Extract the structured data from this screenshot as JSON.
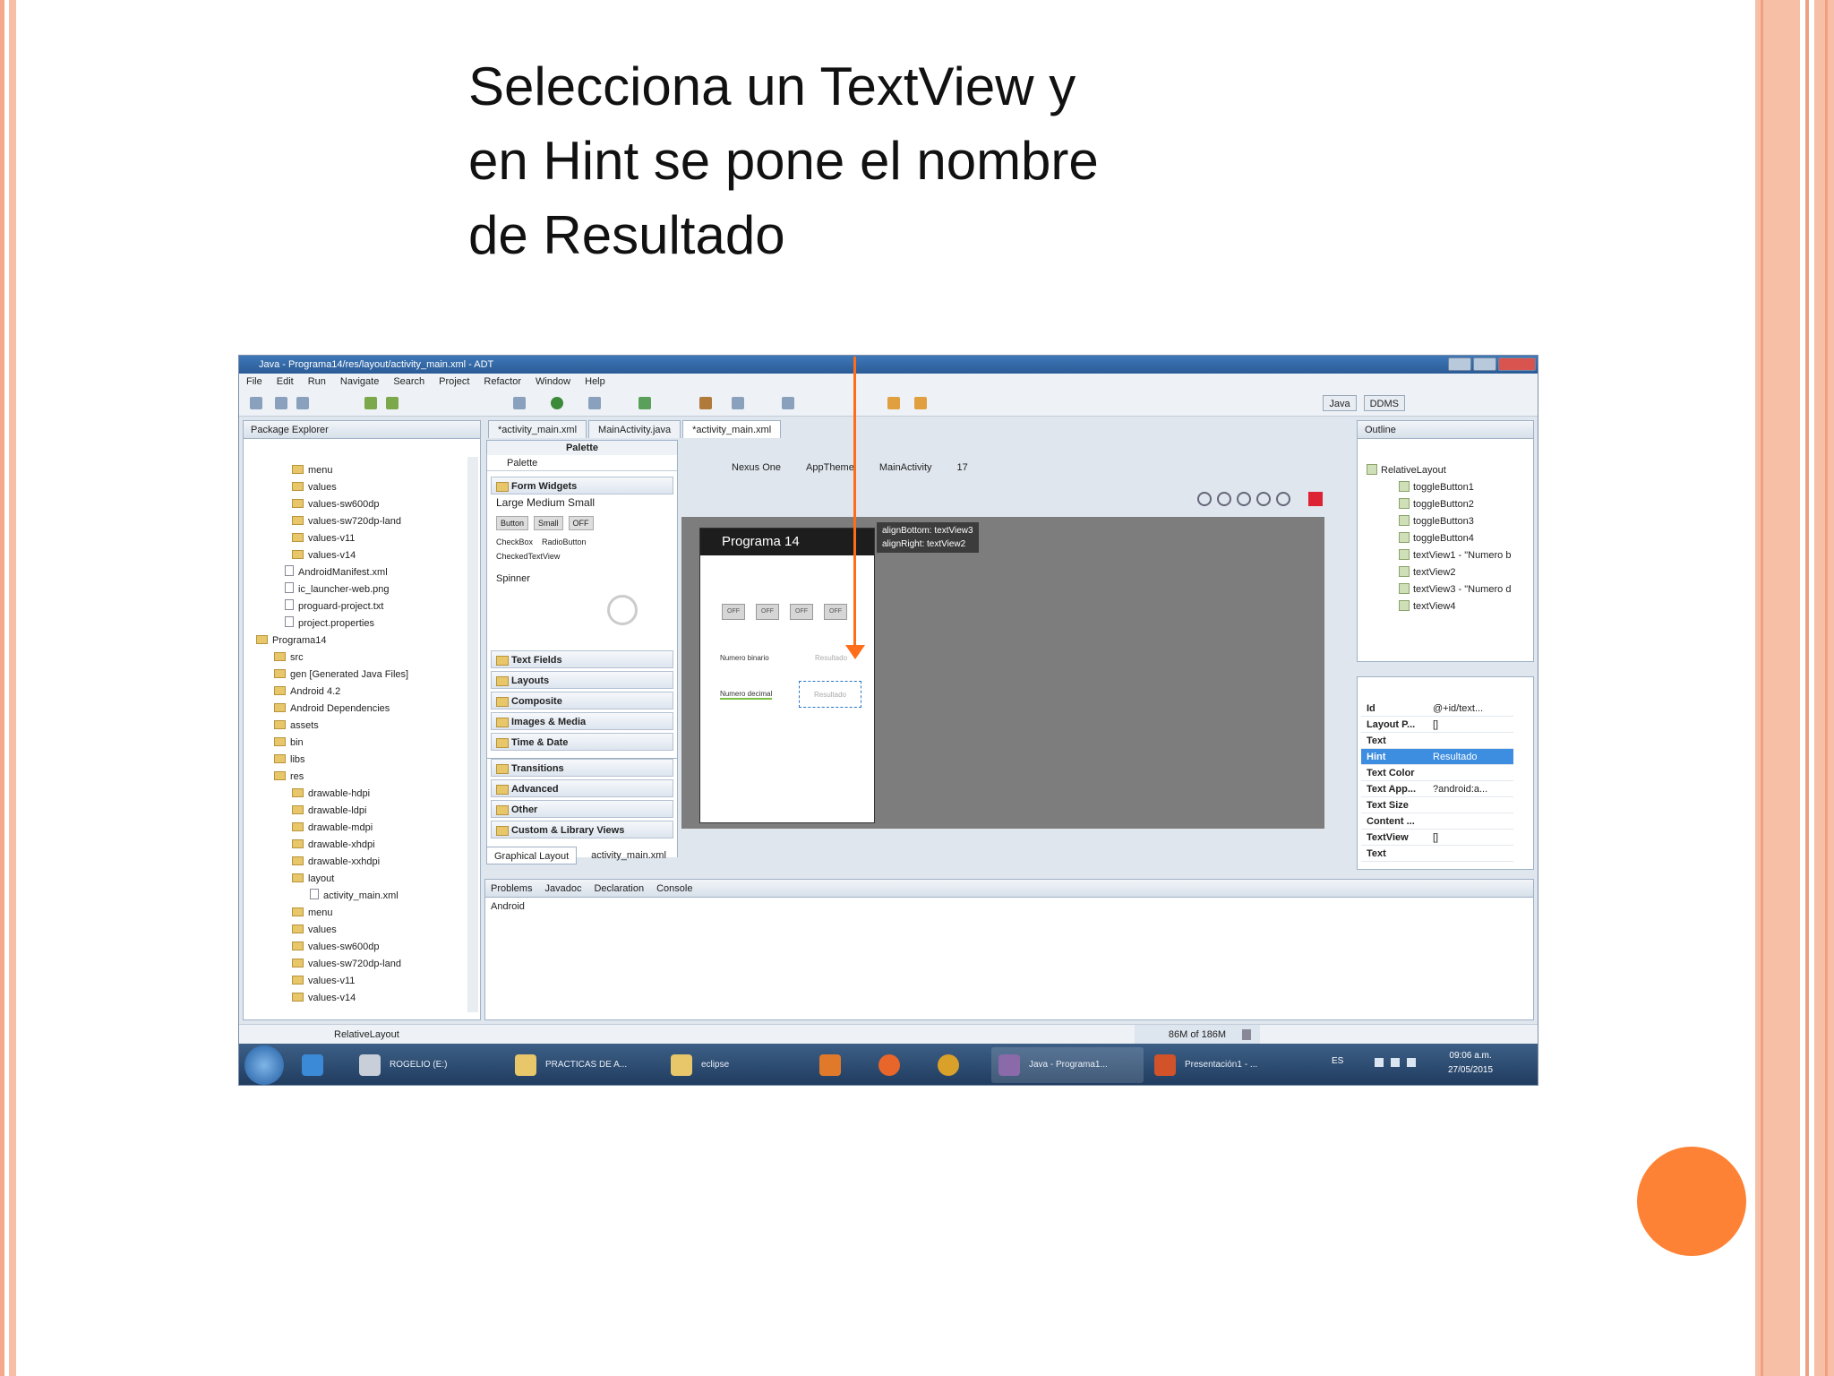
{
  "slide": {
    "title_lines": [
      "Selecciona un TextView y",
      "en Hint se pone el nombre",
      "de Resultado"
    ],
    "colors": {
      "accent": "#fe8236",
      "rail": "#f7c0a6",
      "arrow": "#ff6c1a"
    }
  },
  "ide": {
    "window_title": "Java - Programa14/res/layout/activity_main.xml - ADT",
    "menu": [
      "File",
      "Edit",
      "Run",
      "Navigate",
      "Search",
      "Project",
      "Refactor",
      "Window",
      "Help"
    ],
    "perspectives": [
      "Java",
      "DDMS"
    ],
    "package_explorer": {
      "tab": "Package Explorer",
      "items": [
        "menu",
        "values",
        "values-sw600dp",
        "values-sw720dp-land",
        "values-v11",
        "values-v14",
        "AndroidManifest.xml",
        "ic_launcher-web.png",
        "proguard-project.txt",
        "project.properties",
        "Programa14",
        "src",
        "gen [Generated Java Files]",
        "Android 4.2",
        "Android Dependencies",
        "assets",
        "bin",
        "libs",
        "res",
        "drawable-hdpi",
        "drawable-ldpi",
        "drawable-mdpi",
        "drawable-xhdpi",
        "drawable-xxhdpi",
        "layout",
        "activity_main.xml",
        "menu",
        "values",
        "values-sw600dp",
        "values-sw720dp-land",
        "values-v11",
        "values-v14"
      ]
    },
    "editor_tabs": [
      "*activity_main.xml",
      "MainActivity.java",
      "*activity_main.xml"
    ],
    "palette": {
      "title": "Palette",
      "header": "Palette",
      "open_section": "Form Widgets",
      "sample_text": "Large Medium Small",
      "widgets": [
        "Button",
        "Small",
        "OFF",
        "CheckBox",
        "RadioButton",
        "CheckedTextView",
        "Spinner"
      ],
      "sections": [
        "Text Fields",
        "Layouts",
        "Composite",
        "Images & Media",
        "Time & Date",
        "Transitions",
        "Advanced",
        "Other",
        "Custom & Library Views"
      ]
    },
    "layout_toolbar": [
      "Nexus One",
      "AppTheme",
      "MainActivity",
      "17"
    ],
    "phone": {
      "title": "Programa 14",
      "toggles": [
        "OFF",
        "OFF",
        "OFF",
        "OFF"
      ],
      "label1": "Numero binario",
      "hint1": "Resultado",
      "label2": "Numero decimal",
      "hint2": "Resultado"
    },
    "annotation": [
      "alignBottom: textView3",
      "alignRight: textView2"
    ],
    "layout_tabs": [
      "Graphical Layout",
      "activity_main.xml"
    ],
    "outline": {
      "tab": "Outline",
      "items": [
        "RelativeLayout",
        "toggleButton1",
        "toggleButton2",
        "toggleButton3",
        "toggleButton4",
        "textView1 - \"Numero b",
        "textView2",
        "textView3 - \"Numero d",
        "textView4"
      ]
    },
    "properties": [
      {
        "name": "Id",
        "value": "@+id/text..."
      },
      {
        "name": "Layout P...",
        "value": "[]"
      },
      {
        "name": "Text",
        "value": ""
      },
      {
        "name": "Hint",
        "value": "Resultado"
      },
      {
        "name": "Text Color",
        "value": ""
      },
      {
        "name": "Text App...",
        "value": "?android:a..."
      },
      {
        "name": "Text Size",
        "value": ""
      },
      {
        "name": "Content ...",
        "value": ""
      },
      {
        "name": "TextView",
        "value": "[]"
      },
      {
        "name": "Text",
        "value": ""
      }
    ],
    "bottom_tabs": [
      "Problems",
      "Javadoc",
      "Declaration",
      "Console"
    ],
    "console_text": "Android",
    "status_left": "RelativeLayout",
    "memory": "86M of 186M",
    "taskbar": {
      "items": [
        "ROGELIO (E:)",
        "PRACTICAS DE A...",
        "eclipse",
        "Java - Programa1...",
        "Presentación1 - ..."
      ],
      "lang": "ES",
      "time": "09:06 a.m.",
      "date": "27/05/2015"
    }
  }
}
